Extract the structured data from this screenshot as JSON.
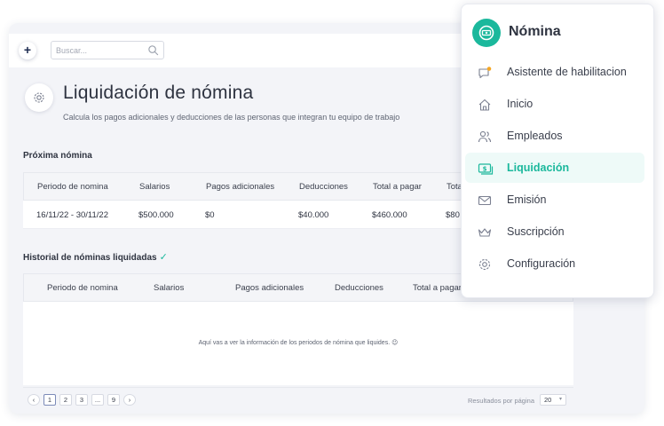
{
  "header": {
    "add_label": "+",
    "search_placeholder": "Buscar..."
  },
  "page": {
    "title": "Liquidación de nómina",
    "subtitle": "Calcula los pagos adicionales y deducciones de las personas que integran tu equipo de trabajo"
  },
  "next_payroll": {
    "title": "Próxima nómina",
    "columns": [
      "Periodo de nomina",
      "Salarios",
      "Pagos adicionales",
      "Deducciones",
      "Total a pagar",
      "Tota"
    ],
    "row": [
      "16/11/22 - 30/11/22",
      "$500.000",
      "$0",
      "$40.000",
      "$460.000",
      "$80"
    ]
  },
  "history": {
    "title": "Historial de nóminas liquidadas",
    "columns": [
      "Periodo de nomina",
      "Salarios",
      "Pagos adicionales",
      "Deducciones",
      "Total a pagar"
    ],
    "empty_message": "Aquí vas a ver la información de los periodos de nómina que liquides. 😉"
  },
  "pagination": {
    "prev": "‹",
    "pages": [
      "1",
      "2",
      "3",
      "...",
      "9"
    ],
    "next": "›",
    "per_page_label": "Resultados por página",
    "per_page_value": "20",
    "current_page": "1"
  },
  "menu": {
    "title": "Nómina",
    "items": [
      {
        "label": "Asistente de habilitacion",
        "icon": "chat-badge-icon"
      },
      {
        "label": "Inicio",
        "icon": "home-icon"
      },
      {
        "label": "Empleados",
        "icon": "users-icon"
      },
      {
        "label": "Liquidación",
        "icon": "money-icon",
        "active": true
      },
      {
        "label": "Emisión",
        "icon": "mail-icon"
      },
      {
        "label": "Suscripción",
        "icon": "crown-icon"
      },
      {
        "label": "Configuración",
        "icon": "gear-icon"
      }
    ]
  },
  "colors": {
    "accent": "#1bb89c",
    "text": "#2e3340",
    "background": "#f3f4f8",
    "badge": "#f5a623"
  }
}
